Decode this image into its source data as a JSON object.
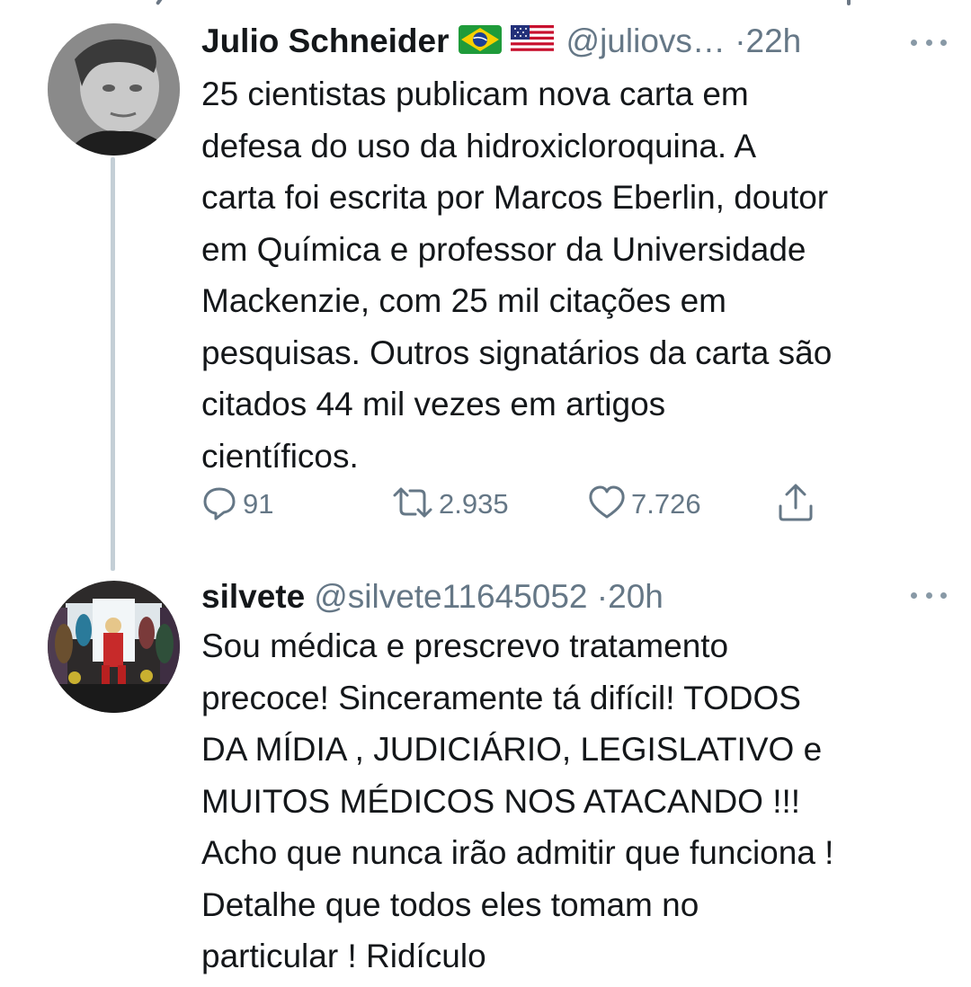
{
  "tweets": [
    {
      "author_name": "Julio Schneider",
      "flags": [
        "brazil-flag",
        "usa-flag"
      ],
      "handle": "@juliovs…",
      "separator": "·",
      "time": "22h",
      "text": "25 cientistas publicam nova carta em\ndefesa do uso da hidroxicloroquina. A\ncarta foi escrita por Marcos Eberlin, doutor\nem Química e professor da Universidade\nMackenzie, com 25 mil citações em\npesquisas. Outros signatários da carta são\ncitados 44 mil vezes em artigos\ncientíficos.",
      "actions": {
        "replies": "91",
        "retweets": "2.935",
        "likes": "7.726"
      }
    },
    {
      "author_name": "silvete",
      "handle": "@silvete11645052",
      "separator": "·",
      "time": "20h",
      "text": "Sou médica e prescrevo tratamento\nprecoce! Sinceramente tá difícil! TODOS\nDA MÍDIA , JUDICIÁRIO, LEGISLATIVO e\nMUITOS MÉDICOS NOS ATACANDO !!!\nAcho que nunca irão admitir que funciona !\nDetalhe que todos eles tomam no\nparticular ! Ridículo"
    }
  ],
  "colors": {
    "text": "#14171a",
    "secondary": "#657786",
    "thread_line": "#c4cfd6",
    "background": "#ffffff"
  },
  "icons": [
    "reply-icon",
    "retweet-icon",
    "like-icon",
    "share-icon",
    "more-icon"
  ]
}
